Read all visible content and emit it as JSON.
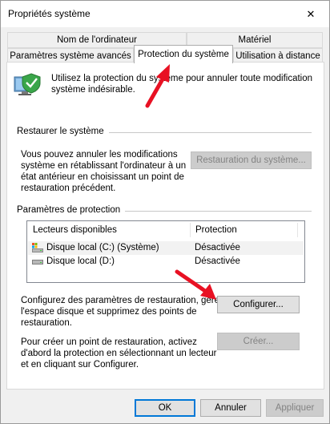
{
  "window": {
    "title": "Propriétés système",
    "close_glyph": "✕"
  },
  "tabs": {
    "row1": [
      "Nom de l'ordinateur",
      "Matériel"
    ],
    "row2": [
      "Paramètres système avancés",
      "Protection du système",
      "Utilisation à distance"
    ]
  },
  "intro": {
    "line1": "Utilisez la protection du système pour annuler toute modification",
    "line2": "système indésirable.",
    "icon": "shield-computer-icon"
  },
  "restore": {
    "title": "Restaurer le système",
    "lines": [
      "Vous pouvez annuler les modifications",
      "système en rétablissant l'ordinateur à un",
      "état antérieur en choisissant un point de",
      "restauration précédent."
    ],
    "button": "Restauration du système..."
  },
  "protection": {
    "title": "Paramètres de protection",
    "columns": [
      "Lecteurs disponibles",
      "Protection"
    ],
    "rows": [
      {
        "drive": "Disque local (C:) (Système)",
        "status": "Désactivée",
        "icon": "system-drive-icon"
      },
      {
        "drive": "Disque local (D:)",
        "status": "Désactivée",
        "icon": "drive-icon"
      }
    ],
    "config_lines": [
      "Configurez des paramètres de restauration, gérez",
      "l'espace disque et supprimez des points de",
      "restauration."
    ],
    "config_button": "Configurer...",
    "create_lines": [
      "Pour créer un point de restauration, activez",
      "d'abord la protection en sélectionnant un lecteur",
      "et en cliquant sur Configurer."
    ],
    "create_button": "Créer..."
  },
  "footer": {
    "ok": "OK",
    "cancel": "Annuler",
    "apply": "Appliquer"
  },
  "colors": {
    "annotation_arrow": "#e81123",
    "focus_blue": "#0078d7",
    "panel": "#ffffff",
    "chrome": "#f0f0f0"
  }
}
